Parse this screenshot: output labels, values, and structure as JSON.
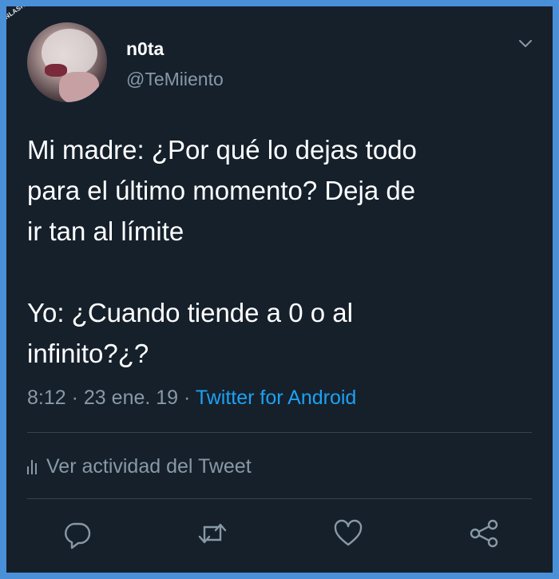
{
  "watermark": "VISTOENLASREDES.com",
  "user": {
    "name": "n0ta",
    "handle": "@TeMiiento"
  },
  "tweet": {
    "text": "Mi madre: ¿Por qué lo dejas todo\npara el último momento? Deja de\nir tan al límite\n\nYo: ¿Cuando tiende a 0 o al\ninfinito?¿?",
    "time": "8:12",
    "date": "23 ene. 19",
    "source": "Twitter for Android"
  },
  "activity": {
    "label": "Ver actividad del Tweet"
  },
  "icons": {
    "menu": "chevron-down-icon",
    "reply": "reply-icon",
    "retweet": "retweet-icon",
    "like": "heart-icon",
    "share": "share-icon",
    "activity": "bar-chart-icon"
  },
  "colors": {
    "background": "#15202b",
    "text": "#ffffff",
    "muted": "#8899a6",
    "accent": "#1da1f2",
    "frame": "#4a90d9"
  }
}
